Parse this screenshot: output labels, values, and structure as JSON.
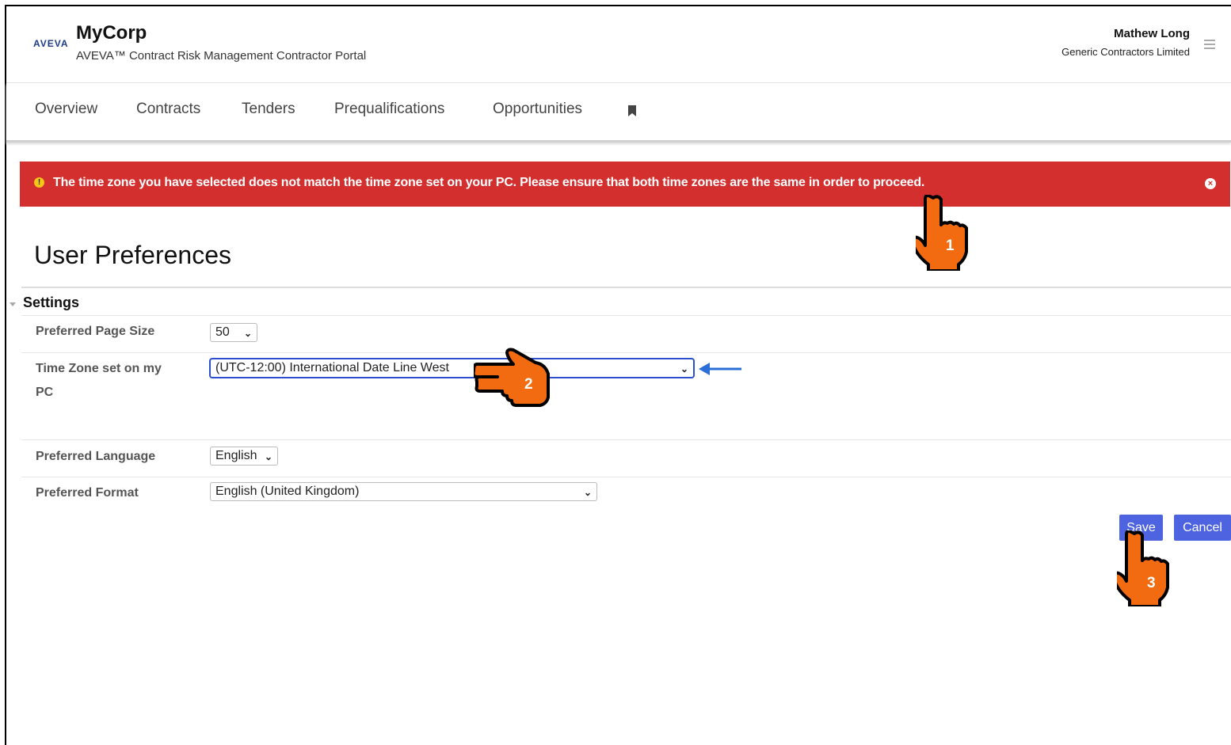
{
  "header": {
    "logo_text": "AVEVA",
    "brand": "MyCorp",
    "subtitle": "AVEVA™ Contract Risk Management Contractor Portal",
    "user_name": "Mathew Long",
    "user_company": "Generic Contractors Limited"
  },
  "nav": {
    "items": [
      "Overview",
      "Contracts",
      "Tenders",
      "Prequalifications",
      "Opportunities"
    ]
  },
  "alert": {
    "icon": "!",
    "message": "The time zone you have selected does not match the time zone set on your PC. Please ensure that both time zones are the same in order to proceed.",
    "close": "×",
    "color": "#d32f2f"
  },
  "page": {
    "title": "User Preferences",
    "section": "Settings"
  },
  "settings": {
    "page_size": {
      "label": "Preferred Page Size",
      "value": "50"
    },
    "time_zone": {
      "label_line1": "Time Zone set on my",
      "label_line2": "PC",
      "value": "(UTC-12:00) International Date Line West"
    },
    "language": {
      "label": "Preferred Language",
      "value": "English"
    },
    "format": {
      "label": "Preferred Format",
      "value": "English (United Kingdom)"
    }
  },
  "actions": {
    "save": "Save",
    "cancel": "Cancel",
    "accent": "#4d63df"
  },
  "annotations": {
    "step1": "1",
    "step2": "2",
    "step3": "3",
    "hand_color": "#f26b11",
    "arrow_color": "#2b6fd6"
  }
}
